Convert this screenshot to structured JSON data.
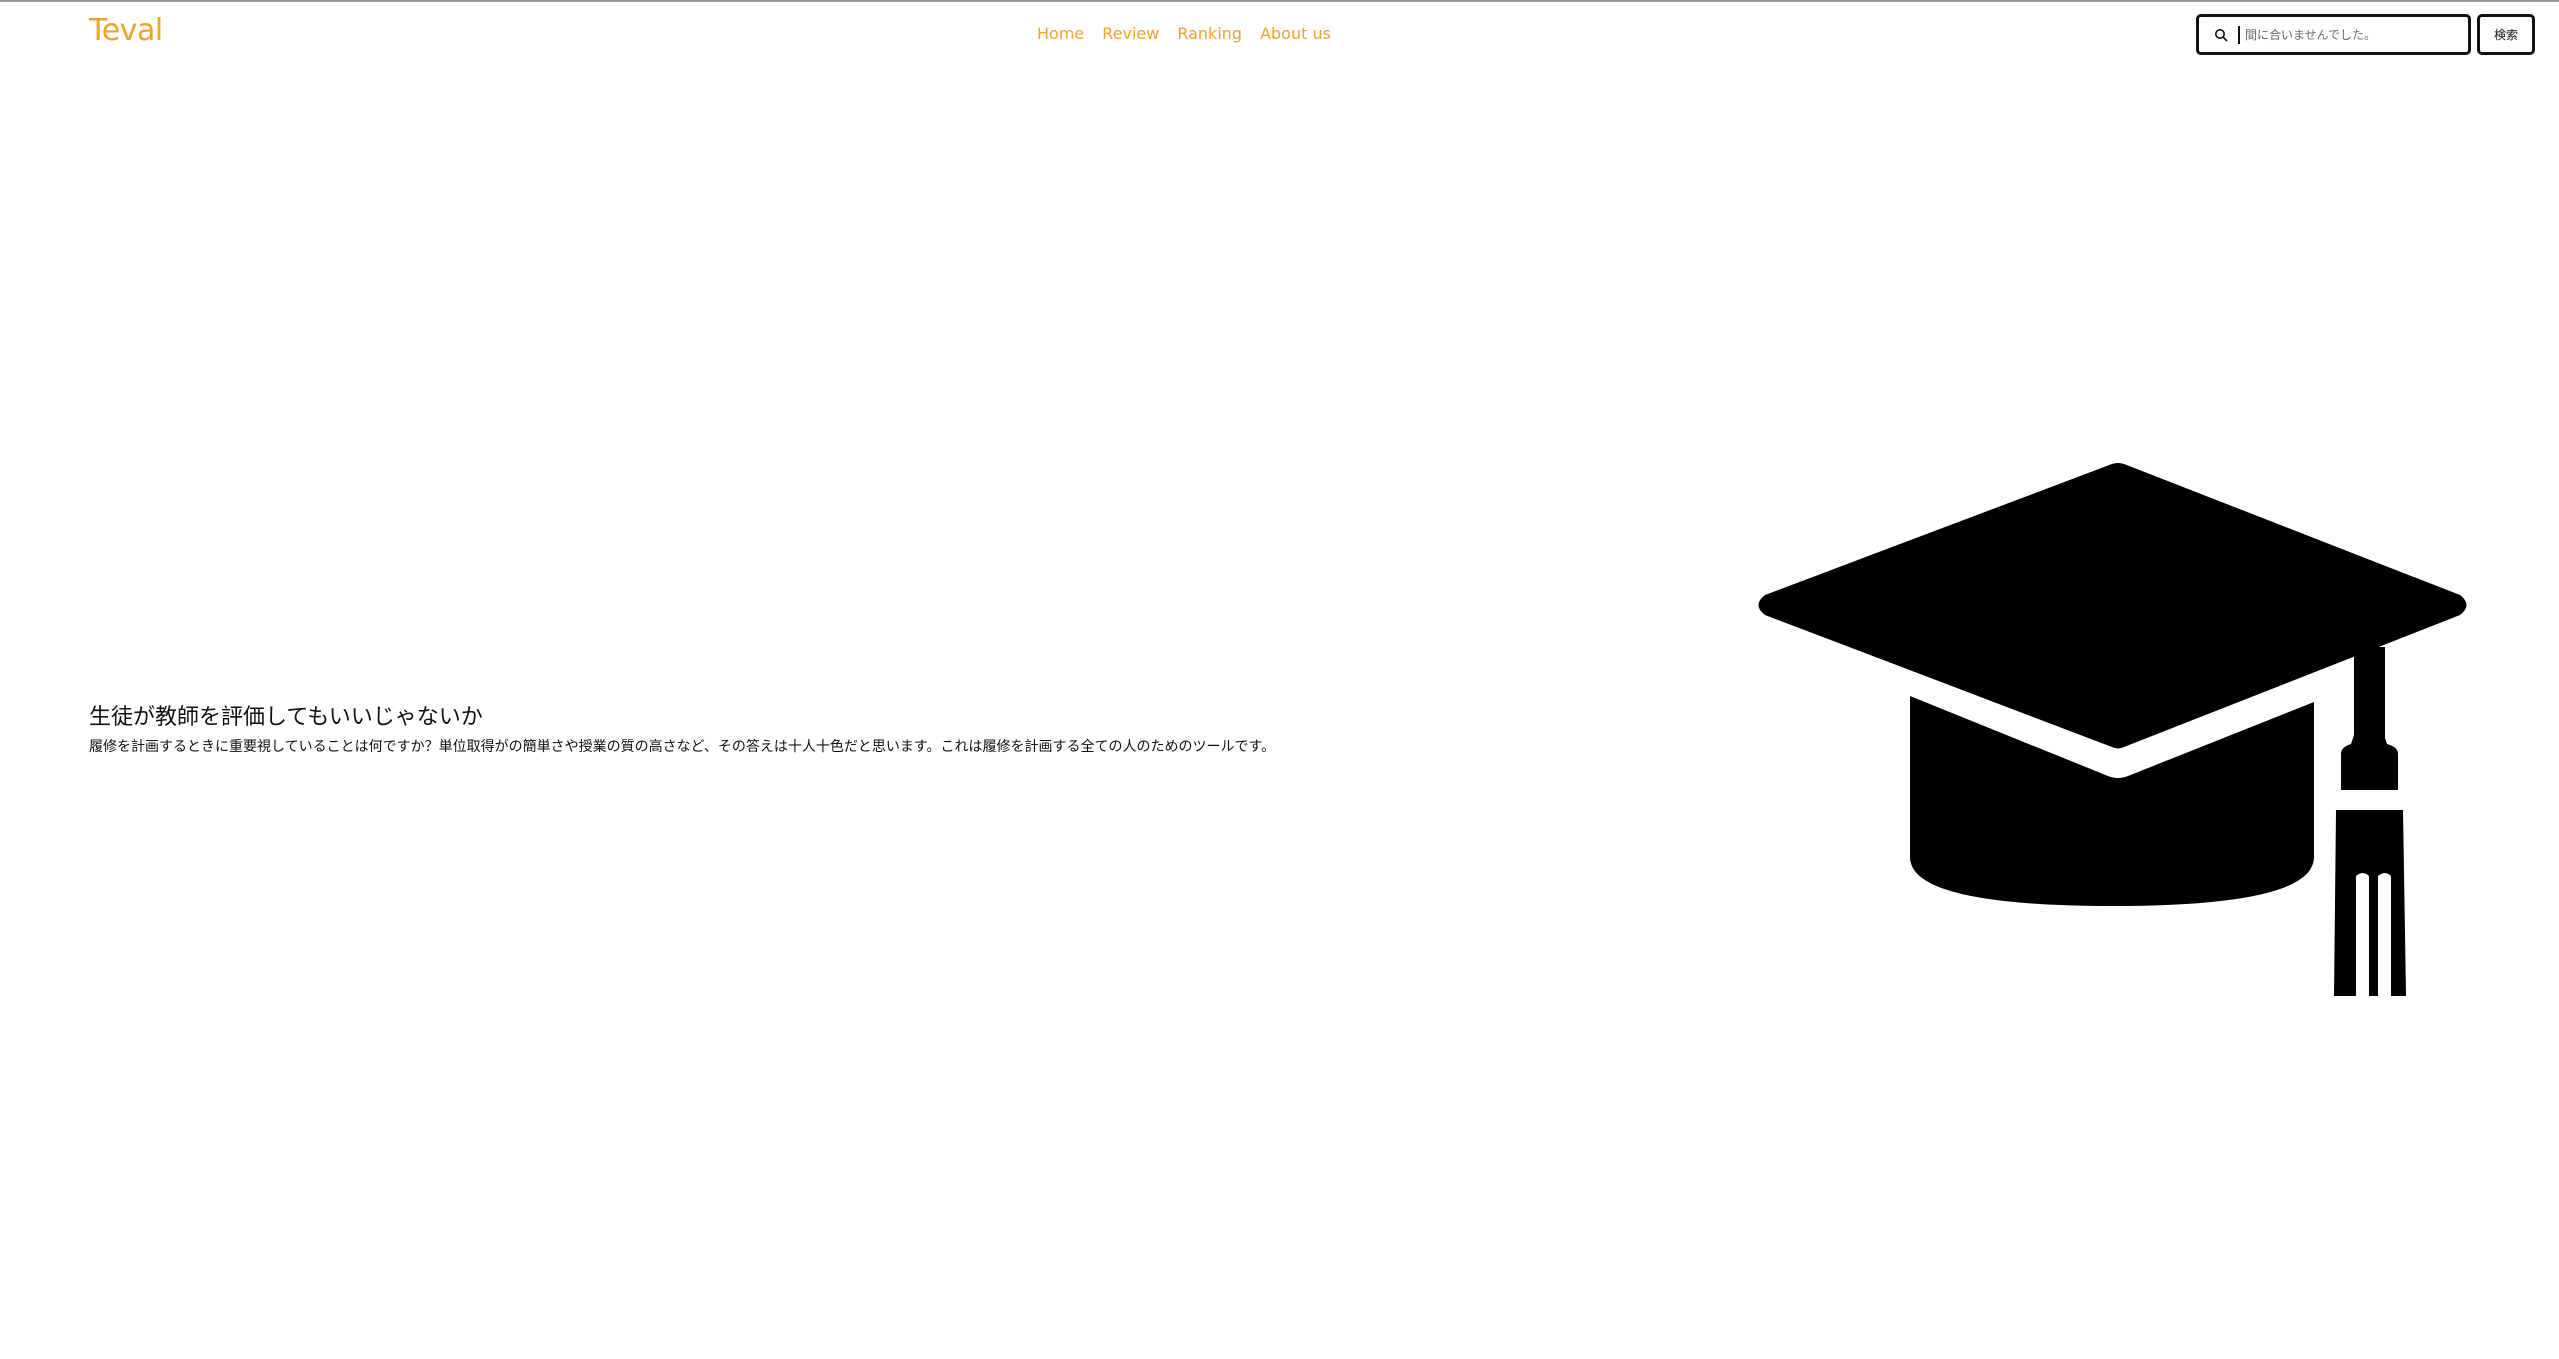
{
  "brand": {
    "name": "Teval",
    "accent_color": "#f2a22b"
  },
  "nav": {
    "items": [
      {
        "label": "Home"
      },
      {
        "label": "Review"
      },
      {
        "label": "Ranking"
      },
      {
        "label": "About us"
      }
    ]
  },
  "search": {
    "icon": "search-icon",
    "placeholder": "間に合いませんでした。",
    "button_label": "検索"
  },
  "hero": {
    "title": "生徒が教師を評価してもいいじゃないか",
    "description": "履修を計画するときに重要視していることは何ですか？単位取得がの簡単さや授業の質の高さなど、その答えは十人十色だと思います。これは履修を計画する全ての人のためのツールです。",
    "illustration": "graduation-cap-icon"
  }
}
